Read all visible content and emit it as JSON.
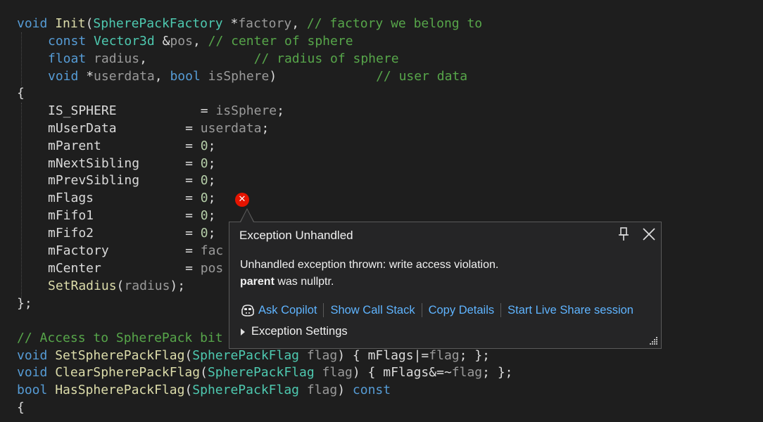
{
  "code": {
    "l1": {
      "a": "void",
      "b": " ",
      "c": "Init",
      "d": "(",
      "e": "SpherePackFactory",
      "f": " *",
      "g": "factory",
      "h": ", ",
      "i": "// factory we belong to"
    },
    "l2": {
      "a": "const",
      "b": " ",
      "c": "Vector3d",
      "d": " &",
      "e": "pos",
      "f": ", ",
      "g": "// center of sphere"
    },
    "l3": {
      "a": "float",
      "b": " ",
      "c": "radius",
      "d": ",              ",
      "e": "// radius of sphere"
    },
    "l4": {
      "a": "void",
      "b": " *",
      "c": "userdata",
      "d": ", ",
      "e": "bool",
      "f": " ",
      "g": "isSphere",
      "h": ")             ",
      "i": "// user data"
    },
    "l5": "{",
    "assignments": [
      {
        "name": "IS_SPHERE",
        "pad": "           = ",
        "value": "isSphere",
        "kind": "param"
      },
      {
        "name": "mUserData",
        "pad": "         = ",
        "value": "userdata",
        "kind": "param"
      },
      {
        "name": "mParent",
        "pad": "           = ",
        "value": "0",
        "kind": "num"
      },
      {
        "name": "mNextSibling",
        "pad": "      = ",
        "value": "0",
        "kind": "num"
      },
      {
        "name": "mPrevSibling",
        "pad": "      = ",
        "value": "0",
        "kind": "num"
      },
      {
        "name": "mFlags",
        "pad": "            = ",
        "value": "0",
        "kind": "num"
      },
      {
        "name": "mFifo1",
        "pad": "            = ",
        "value": "0",
        "kind": "num"
      },
      {
        "name": "mFifo2",
        "pad": "            = ",
        "value": "0",
        "kind": "num"
      },
      {
        "name": "mFactory",
        "pad": "          = ",
        "value": "fac",
        "kind": "param"
      },
      {
        "name": "mCenter",
        "pad": "           = ",
        "value": "pos",
        "kind": "param"
      }
    ],
    "l16": {
      "a": "SetRadius",
      "b": "(",
      "c": "radius",
      "d": ");"
    },
    "l17": "};",
    "l19": "// Access to SpherePack bit",
    "l20": {
      "a": "void",
      "b": " ",
      "c": "SetSpherePackFlag",
      "d": "(",
      "e": "SpherePackFlag",
      "f": " ",
      "g": "flag",
      "h": ") { ",
      "i": "mFlags",
      "j": "|=",
      "k": "flag",
      "l": "; };"
    },
    "l21": {
      "a": "void",
      "b": " ",
      "c": "ClearSpherePackFlag",
      "d": "(",
      "e": "SpherePackFlag",
      "f": " ",
      "g": "flag",
      "h": ") { ",
      "i": "mFlags",
      "j": "&=~",
      "k": "flag",
      "l": "; };"
    },
    "l22": {
      "a": "bool",
      "b": " ",
      "c": "HasSpherePackFlag",
      "d": "(",
      "e": "SpherePackFlag",
      "f": " ",
      "g": "flag",
      "h": ") ",
      "i": "const"
    },
    "l23": "{"
  },
  "popup": {
    "title": "Exception Unhandled",
    "message_line1": "Unhandled exception thrown: write access violation.",
    "message_var": "parent",
    "message_rest": " was nullptr.",
    "actions": [
      "Ask Copilot",
      "Show Call Stack",
      "Copy Details",
      "Start Live Share session"
    ],
    "settings_label": "Exception Settings"
  },
  "icons": {
    "error": "error-x-icon",
    "pin": "pin-icon",
    "close": "close-icon",
    "copilot": "copilot-icon",
    "expand": "expand-triangle-icon",
    "grip": "resize-grip-icon"
  },
  "colors": {
    "background": "#1e1e1e",
    "keyword": "#569cd6",
    "function": "#dcdcaa",
    "type": "#4ec9b0",
    "comment": "#57a64a",
    "number": "#b5cea8",
    "link": "#5fb4ff",
    "error": "#e51400"
  }
}
